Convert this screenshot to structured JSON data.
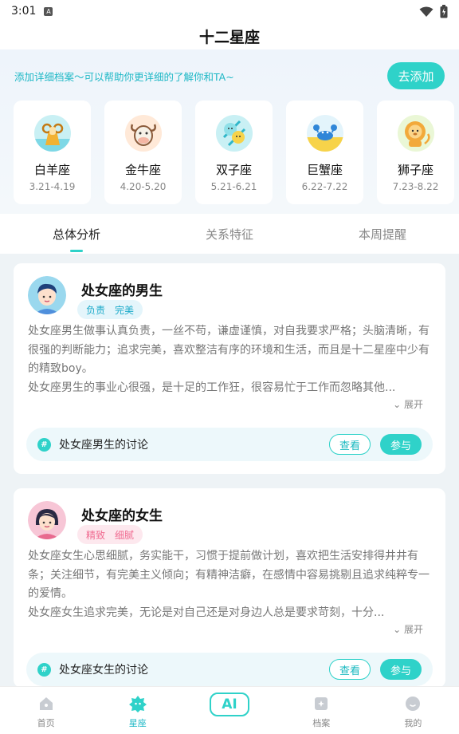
{
  "status_bar": {
    "time": "3:01",
    "notif_glyph": "A"
  },
  "header": {
    "title": "十二星座"
  },
  "promo": {
    "text": "添加详细档案～可以帮助你更详细的了解你和TA~",
    "button": "去添加"
  },
  "zodiacs": [
    {
      "name": "白羊座",
      "date": "3.21-4.19",
      "icon": "ram-icon"
    },
    {
      "name": "金牛座",
      "date": "4.20-5.20",
      "icon": "bull-icon"
    },
    {
      "name": "双子座",
      "date": "5.21-6.21",
      "icon": "twins-icon"
    },
    {
      "name": "巨蟹座",
      "date": "6.22-7.22",
      "icon": "crab-icon"
    },
    {
      "name": "狮子座",
      "date": "7.23-8.22",
      "icon": "lion-icon"
    }
  ],
  "tabs": [
    {
      "label": "总体分析",
      "active": true
    },
    {
      "label": "关系特征",
      "active": false
    },
    {
      "label": "本周提醒",
      "active": false
    }
  ],
  "male": {
    "title": "处女座的男生",
    "tags": [
      "负责",
      "完美"
    ],
    "desc1": "处女座男生做事认真负责，一丝不苟，谦虚谨慎，对自我要求严格；头脑清晰，有很强的判断能力；追求完美，喜欢整洁有序的环境和生活，而且是十二星座中少有的精致boy。",
    "desc2": "处女座男生的事业心很强，是十足的工作狂，很容易忙于工作而忽略其他...",
    "expand": "展开",
    "discussion": "处女座男生的讨论",
    "view": "查看",
    "join": "参与"
  },
  "female": {
    "title": "处女座的女生",
    "tags": [
      "精致",
      "细腻"
    ],
    "desc1": "处女座女生心思细腻，务实能干，习惯于提前做计划，喜欢把生活安排得井井有条；关注细节，有完美主义倾向；有精神洁癖，在感情中容易挑剔且追求纯粹专一的爱情。",
    "desc2": "处女座女生追求完美，无论是对自己还是对身边人总是要求苛刻，十分...",
    "expand": "展开",
    "discussion": "处女座女生的讨论",
    "view": "查看",
    "join": "参与"
  },
  "nav": [
    {
      "label": "首页",
      "icon": "home-icon",
      "active": false
    },
    {
      "label": "星座",
      "icon": "star-icon",
      "active": true
    },
    {
      "label": "AI",
      "icon": "ai-icon",
      "active": false
    },
    {
      "label": "档案",
      "icon": "archive-icon",
      "active": false
    },
    {
      "label": "我的",
      "icon": "profile-icon",
      "active": false
    }
  ],
  "colors": {
    "accent": "#2fd2c9",
    "accent_text": "#1fb8c6",
    "pink_tag": "#f06a90",
    "blue_tag": "#19a9c9"
  }
}
